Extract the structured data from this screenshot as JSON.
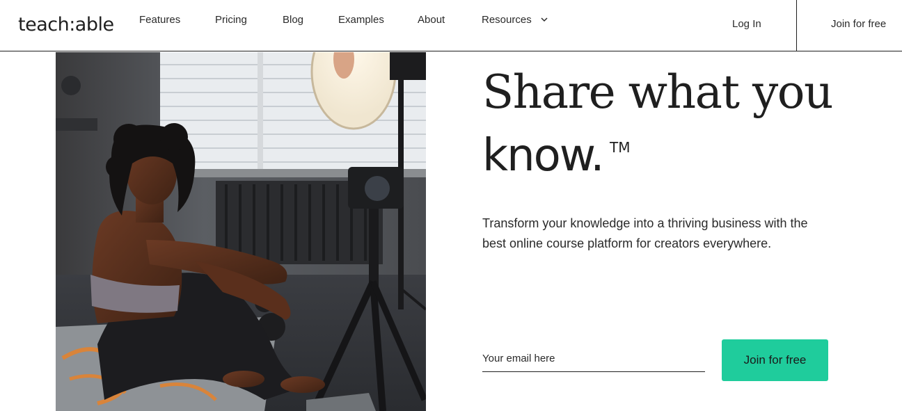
{
  "header": {
    "logo": "teach:able",
    "nav": {
      "features": "Features",
      "pricing": "Pricing",
      "blog": "Blog",
      "examples": "Examples",
      "about": "About",
      "resources": "Resources"
    },
    "login": "Log In",
    "join": "Join for free"
  },
  "hero": {
    "title_line1": "Share what you",
    "title_line2": "know.",
    "trademark": "TM",
    "subtitle": "Transform your knowledge into a thriving business with the best online course platform for creators everywhere.",
    "email_placeholder": "Your email here",
    "cta_label": "Join for free"
  },
  "colors": {
    "accent": "#1fcc9c",
    "text": "#1f1f1f"
  },
  "icons": {
    "resources_dropdown": "chevron-down-icon"
  }
}
